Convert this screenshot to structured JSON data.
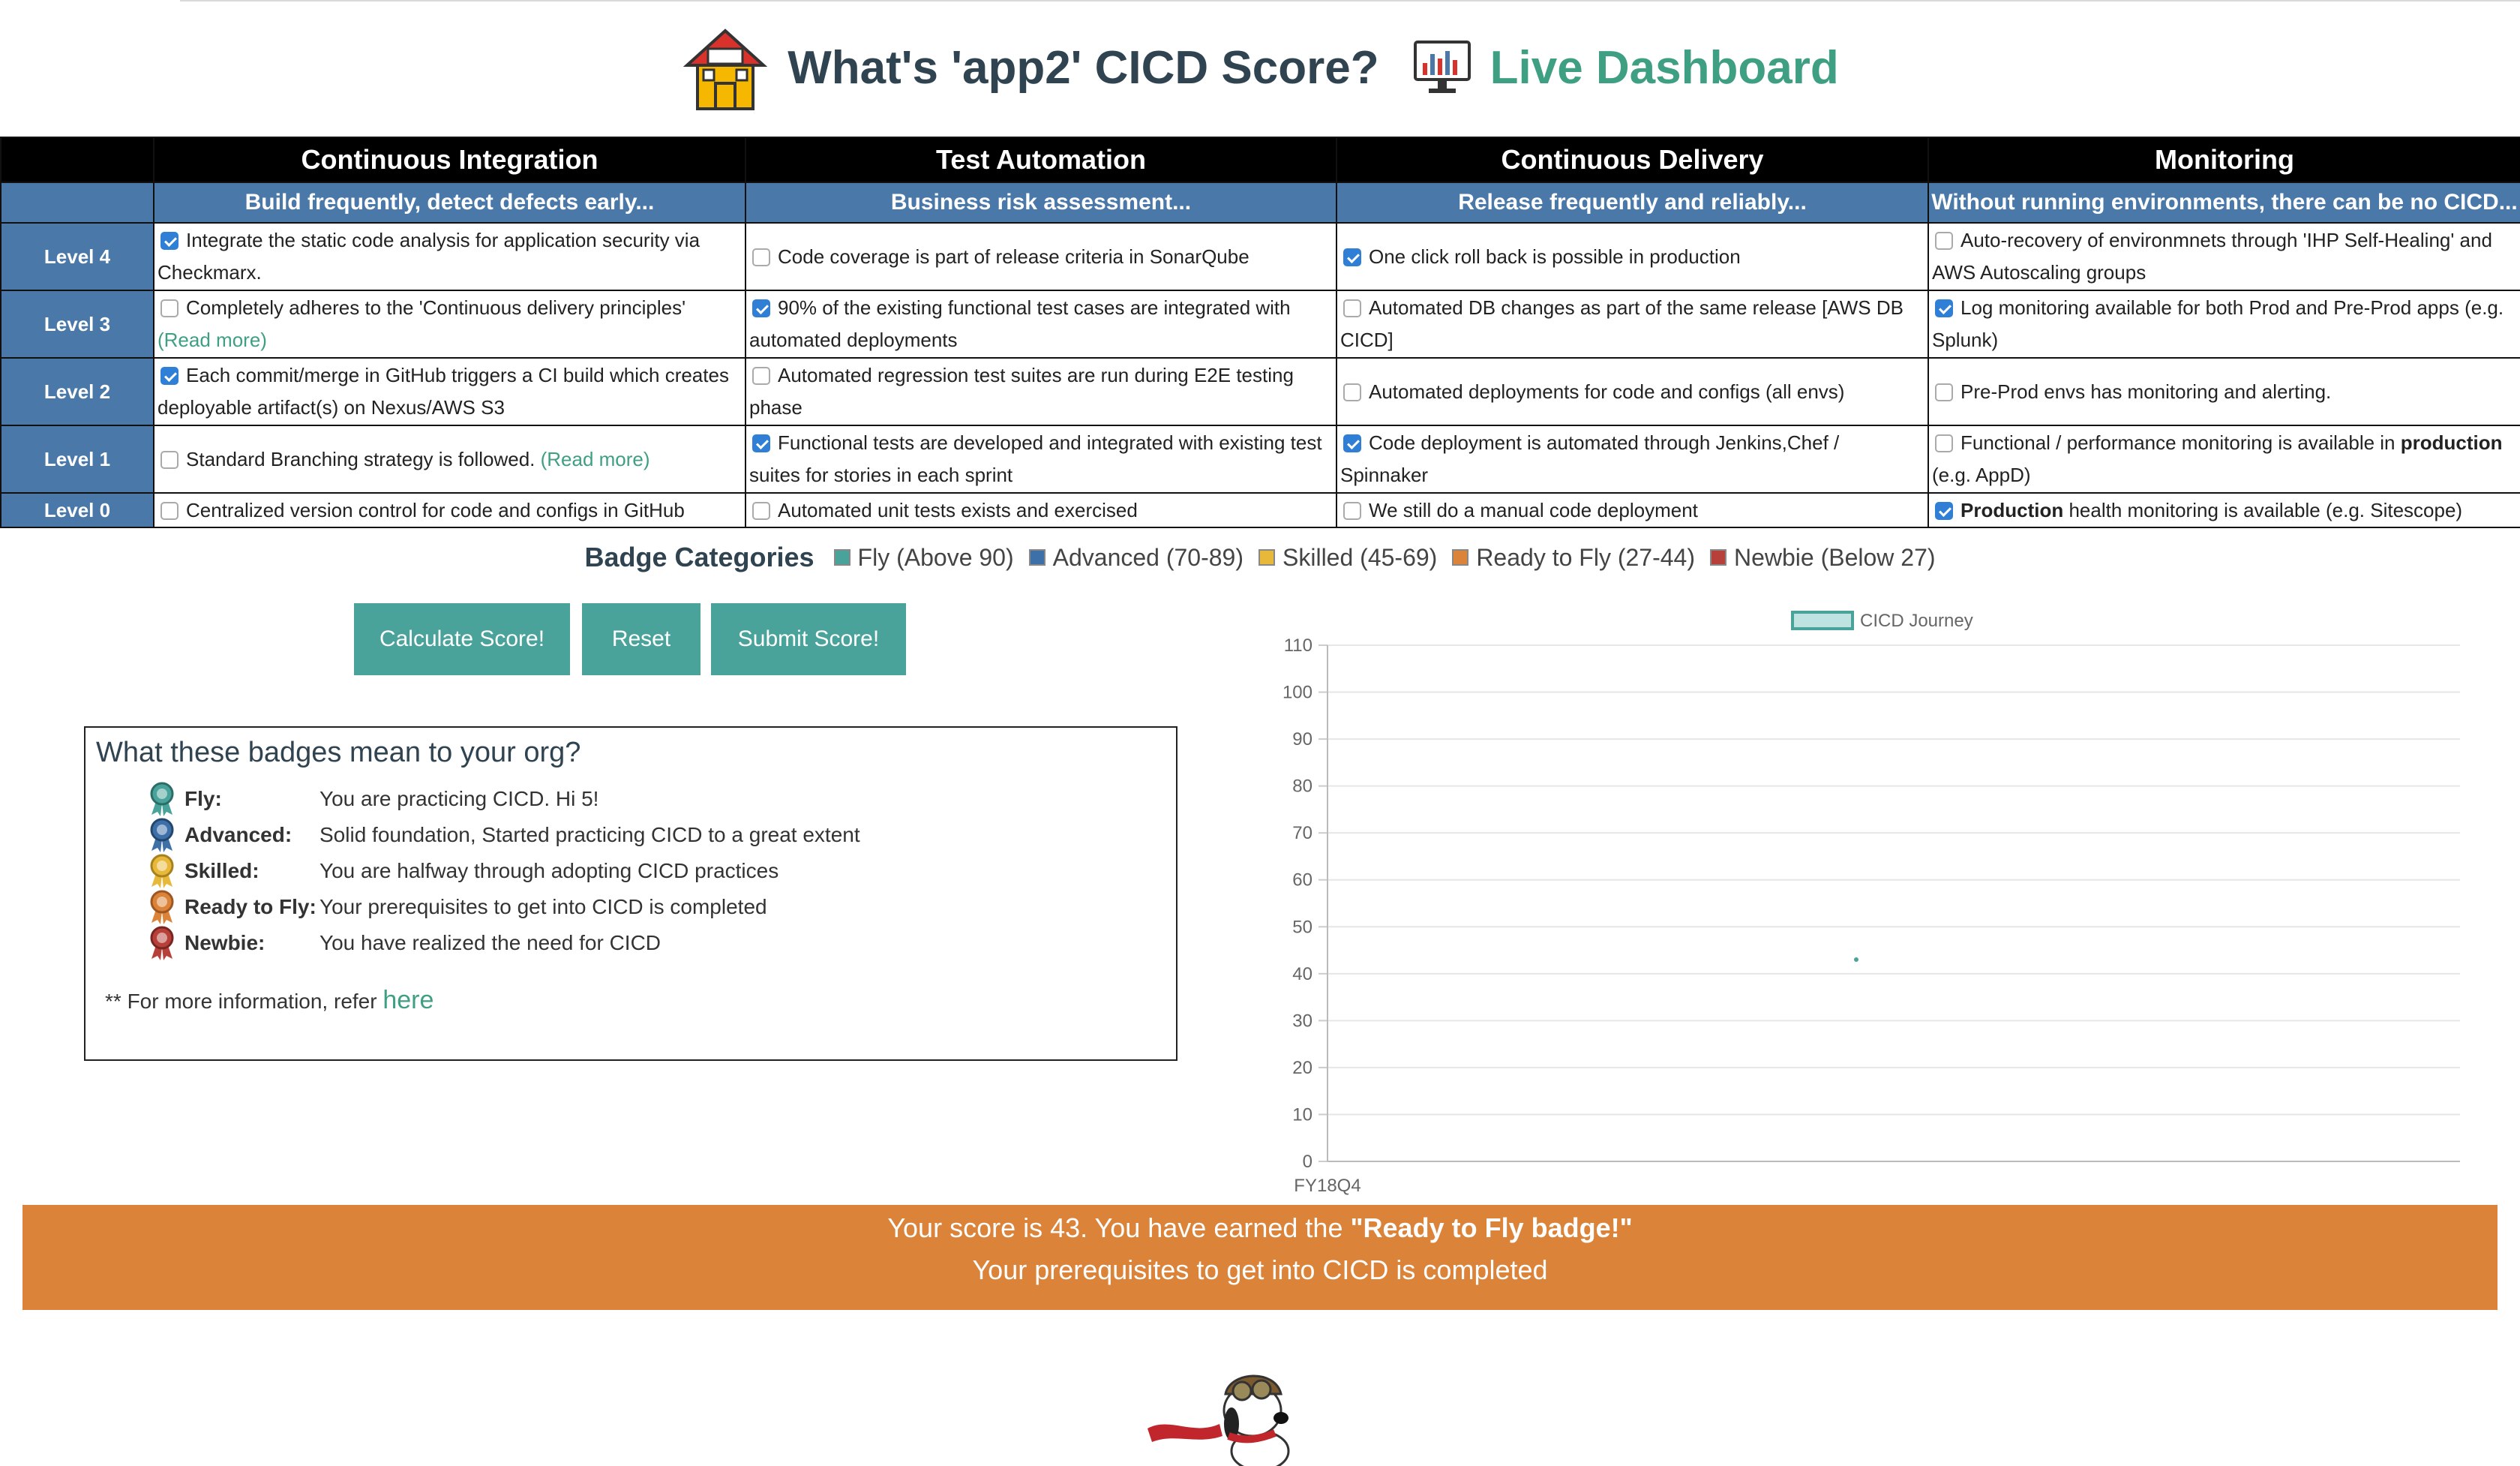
{
  "header": {
    "title": "What's 'app2' CICD Score?",
    "dashboard_link": "Live Dashboard"
  },
  "matrix": {
    "categories": [
      "Continuous Integration",
      "Test Automation",
      "Continuous Delivery",
      "Monitoring"
    ],
    "subtitles": [
      "Build frequently, detect defects early...",
      "Business risk assessment...",
      "Release frequently and reliably...",
      "Without running environments, there can be no CICD..."
    ],
    "levels": [
      {
        "label": "Level 4",
        "cells": [
          {
            "checked": true,
            "text": "Integrate the static code analysis for application security via Checkmarx."
          },
          {
            "checked": false,
            "text": "Code coverage is part of release criteria in SonarQube"
          },
          {
            "checked": true,
            "text": "One click roll back is possible in production"
          },
          {
            "checked": false,
            "text": "Auto-recovery of environmnets through 'IHP Self-Healing' and AWS Autoscaling groups"
          }
        ]
      },
      {
        "label": "Level 3",
        "cells": [
          {
            "checked": false,
            "text": "Completely adheres to the 'Continuous delivery principles'",
            "link": "(Read more)"
          },
          {
            "checked": true,
            "text": "90% of the existing functional test cases are integrated with automated deployments"
          },
          {
            "checked": false,
            "text": "Automated DB changes as part of the same release [AWS DB CICD]"
          },
          {
            "checked": true,
            "text": "Log monitoring available for both Prod and Pre-Prod apps (e.g. Splunk)"
          }
        ]
      },
      {
        "label": "Level 2",
        "cells": [
          {
            "checked": true,
            "text": "Each commit/merge in GitHub triggers a CI build which creates deployable artifact(s) on Nexus/AWS S3"
          },
          {
            "checked": false,
            "text": "Automated regression test suites are run during E2E testing phase"
          },
          {
            "checked": false,
            "text": "Automated deployments for code and configs (all envs)"
          },
          {
            "checked": false,
            "text": "Pre-Prod envs has monitoring and alerting."
          }
        ]
      },
      {
        "label": "Level 1",
        "cells": [
          {
            "checked": false,
            "text": "Standard Branching strategy is followed.",
            "link": "(Read more)"
          },
          {
            "checked": true,
            "text": "Functional tests are developed and integrated with existing test suites for stories in each sprint"
          },
          {
            "checked": true,
            "text": "Code deployment is automated through Jenkins,Chef / Spinnaker"
          },
          {
            "checked": false,
            "text_before": "Functional / performance monitoring is available in ",
            "bold": "production",
            "text_after": " (e.g. AppD)"
          }
        ]
      },
      {
        "label": "Level 0",
        "cells": [
          {
            "checked": false,
            "text": "Centralized version control for code and configs in GitHub"
          },
          {
            "checked": false,
            "text": "Automated unit tests exists and exercised"
          },
          {
            "checked": false,
            "text": "We still do a manual code deployment"
          },
          {
            "checked": true,
            "bold": "Production",
            "text_after": " health monitoring is available (e.g. Sitescope)"
          }
        ]
      }
    ]
  },
  "legend": {
    "title": "Badge Categories",
    "items": [
      {
        "label": "Fly (Above 90)",
        "color": "#4aa39b"
      },
      {
        "label": "Advanced (70-89)",
        "color": "#3d6fa8"
      },
      {
        "label": "Skilled (45-69)",
        "color": "#e8b83a"
      },
      {
        "label": "Ready to Fly (27-44)",
        "color": "#dc833a"
      },
      {
        "label": "Newbie (Below 27)",
        "color": "#b7413a"
      }
    ]
  },
  "buttons": {
    "calculate": "Calculate Score!",
    "reset": "Reset",
    "submit": "Submit Score!"
  },
  "info": {
    "title": "What these badges mean to your org?",
    "badges": [
      {
        "name": "Fly:",
        "desc": "You are practicing CICD. Hi 5!",
        "color": "#4aa39b"
      },
      {
        "name": "Advanced:",
        "desc": "Solid foundation, Started practicing CICD to a great extent",
        "color": "#3d6fa8"
      },
      {
        "name": "Skilled:",
        "desc": "You are halfway through adopting CICD practices",
        "color": "#e8b83a"
      },
      {
        "name": "Ready to Fly:",
        "desc": "Your prerequisites to get into CICD is completed",
        "color": "#dc833a"
      },
      {
        "name": "Newbie:",
        "desc": "You have realized the need for CICD",
        "color": "#b7413a"
      }
    ],
    "more_prefix": "** For more information, refer ",
    "more_link": "here"
  },
  "chart_data": {
    "type": "line",
    "categories": [
      "FY18Q4"
    ],
    "series": [
      {
        "name": "CICD Journey",
        "values": [
          43
        ],
        "color": "#4aa39b"
      }
    ],
    "ylim": [
      0,
      110
    ],
    "yticks": [
      0,
      10,
      20,
      30,
      40,
      50,
      60,
      70,
      80,
      90,
      100,
      110
    ],
    "legend": "top-center",
    "grid": true
  },
  "result": {
    "line1_prefix": "Your score is 43. You have earned the ",
    "line1_badge": "\"Ready to Fly badge!\"",
    "line2": "Your prerequisites to get into CICD is completed",
    "color": "#dc833a"
  }
}
